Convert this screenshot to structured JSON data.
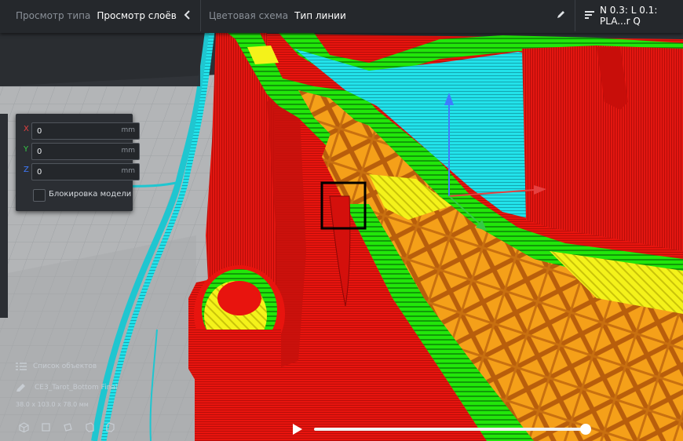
{
  "toolbar": {
    "view_type_label": "Просмотр типа",
    "view_type_value": "Просмотр слоёв",
    "color_scheme_label": "Цветовая схема",
    "color_scheme_value": "Тип линии",
    "profile_summary": "N 0.3: L 0.1: PLA...r Q"
  },
  "move_panel": {
    "x": {
      "axis": "X",
      "value": "0",
      "unit": "mm"
    },
    "y": {
      "axis": "Y",
      "value": "0",
      "unit": "mm"
    },
    "z": {
      "axis": "Z",
      "value": "0",
      "unit": "mm"
    },
    "lock_label": "Блокировка модели"
  },
  "object_list": {
    "title": "Список объектов",
    "object_name": "CE3_Tarot_Bottom Final",
    "dimensions": "38.0 x 103.0 x 78.0 мм"
  },
  "colors": {
    "wall_outer": "#e8140e",
    "wall_inner": "#22e60a",
    "infill": "#f5a019",
    "skin": "#f4f21a",
    "support_cyan": "#20e4ea",
    "axis_x": "#e64040",
    "axis_y": "#35c947",
    "axis_z": "#3f7bff"
  },
  "icons": [
    "chevron-left-icon",
    "pencil-icon",
    "settings-list-icon",
    "list-icon",
    "pen-icon",
    "cube-view-icon",
    "play-icon"
  ]
}
